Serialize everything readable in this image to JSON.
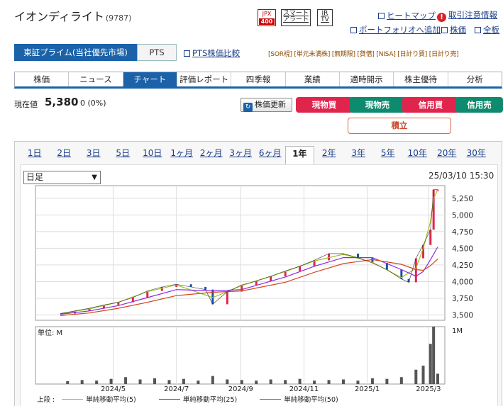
{
  "header": {
    "title": "イオンディライト",
    "code": "(9787)",
    "jpx_top": "JPX",
    "jpx_bottom": "400",
    "smart_alert_1": "スマート",
    "smart_alert_2": "アラート",
    "ir_1": "IR",
    "ir_2": "TV",
    "heatmap": "ヒートマップ",
    "caution": "取引注意情報",
    "portfolio": "ポートフォリオへ追加",
    "stock_price": "株価",
    "all_stocks": "全板"
  },
  "market": {
    "primary": "東証プライム(当社優先市場)",
    "pts": "PTS",
    "pts_compare": "PTS株価比較",
    "rules": "[SOR視] [単元未満株] [無期限] [貸借] [NISA] [日計り買] [日計り売]"
  },
  "nav": {
    "tabs": [
      "株価",
      "ニュース",
      "チャート",
      "評価レポート",
      "四季報",
      "業績",
      "適時開示",
      "株主優待",
      "分析"
    ],
    "active": 2
  },
  "quote": {
    "label": "現在値",
    "price": "5,380",
    "change": "0 (0%)",
    "refresh": "株価更新",
    "buy_spot": "現物買",
    "sell_spot": "現物売",
    "buy_margin": "信用買",
    "sell_margin": "信用売",
    "tsumitate": "積立"
  },
  "period": {
    "tabs": [
      "1日",
      "2日",
      "3日",
      "5日",
      "10日",
      "1ヶ月",
      "2ヶ月",
      "3ヶ月",
      "6ヶ月",
      "1年",
      "2年",
      "3年",
      "5年",
      "10年",
      "20年",
      "30年"
    ],
    "active": 9
  },
  "chart_controls": {
    "interval": "日足",
    "datetime": "25/03/10 15:30"
  },
  "chart_data": {
    "type": "line",
    "price_yticks": [
      3500,
      3750,
      4000,
      4250,
      4500,
      4750,
      5000,
      5250
    ],
    "price_ytick_labels": [
      "3,500",
      "3,750",
      "4,000",
      "4,250",
      "4,500",
      "4,750",
      "5,000",
      "5,250"
    ],
    "price_ylim": [
      3420,
      5440
    ],
    "x_range": [
      "2024-03-11",
      "2025-03-10"
    ],
    "x_ticks": [
      "2024/5",
      "2024/7",
      "2024/9",
      "2024/11",
      "2025/1",
      "2025/3"
    ],
    "volume_label": "単位: M",
    "volume_ytick": "1M",
    "close": [
      [
        "2024-03-11",
        3520
      ],
      [
        "2024-03-25",
        3560
      ],
      [
        "2024-04-08",
        3600
      ],
      [
        "2024-04-22",
        3650
      ],
      [
        "2024-05-06",
        3690
      ],
      [
        "2024-05-20",
        3760
      ],
      [
        "2024-06-03",
        3860
      ],
      [
        "2024-06-17",
        3920
      ],
      [
        "2024-07-01",
        3960
      ],
      [
        "2024-07-15",
        3920
      ],
      [
        "2024-07-29",
        3880
      ],
      [
        "2024-08-05",
        3660
      ],
      [
        "2024-08-19",
        3850
      ],
      [
        "2024-09-02",
        3950
      ],
      [
        "2024-09-16",
        4010
      ],
      [
        "2024-09-30",
        4080
      ],
      [
        "2024-10-14",
        4160
      ],
      [
        "2024-10-28",
        4230
      ],
      [
        "2024-11-11",
        4320
      ],
      [
        "2024-11-25",
        4420
      ],
      [
        "2024-12-09",
        4420
      ],
      [
        "2024-12-23",
        4360
      ],
      [
        "2025-01-06",
        4280
      ],
      [
        "2025-01-20",
        4180
      ],
      [
        "2025-02-03",
        4040
      ],
      [
        "2025-02-10",
        3990
      ],
      [
        "2025-02-17",
        4350
      ],
      [
        "2025-02-24",
        4550
      ],
      [
        "2025-03-03",
        4780
      ],
      [
        "2025-03-06",
        5380
      ],
      [
        "2025-03-10",
        5380
      ]
    ],
    "series": [
      {
        "name": "単純移動平均(5)",
        "color": "#9bc31c",
        "values": [
          [
            "2024-03-11",
            3520
          ],
          [
            "2024-04-08",
            3590
          ],
          [
            "2024-05-06",
            3690
          ],
          [
            "2024-06-03",
            3850
          ],
          [
            "2024-07-01",
            3950
          ],
          [
            "2024-08-05",
            3760
          ],
          [
            "2024-09-02",
            3940
          ],
          [
            "2024-10-14",
            4150
          ],
          [
            "2024-11-11",
            4310
          ],
          [
            "2024-12-09",
            4410
          ],
          [
            "2025-01-06",
            4290
          ],
          [
            "2025-02-03",
            4060
          ],
          [
            "2025-02-17",
            4200
          ],
          [
            "2025-02-24",
            4500
          ],
          [
            "2025-03-03",
            4900
          ],
          [
            "2025-03-06",
            5250
          ],
          [
            "2025-03-10",
            5380
          ]
        ]
      },
      {
        "name": "単純移動平均(25)",
        "color": "#8a2be2",
        "values": [
          [
            "2024-03-11",
            3510
          ],
          [
            "2024-04-08",
            3560
          ],
          [
            "2024-05-06",
            3640
          ],
          [
            "2024-06-03",
            3760
          ],
          [
            "2024-07-01",
            3880
          ],
          [
            "2024-08-05",
            3860
          ],
          [
            "2024-09-02",
            3880
          ],
          [
            "2024-10-14",
            4070
          ],
          [
            "2024-11-11",
            4230
          ],
          [
            "2024-12-09",
            4360
          ],
          [
            "2025-01-06",
            4360
          ],
          [
            "2025-02-03",
            4180
          ],
          [
            "2025-02-17",
            4080
          ],
          [
            "2025-02-24",
            4150
          ],
          [
            "2025-03-03",
            4330
          ],
          [
            "2025-03-10",
            4520
          ]
        ]
      },
      {
        "name": "単純移動平均(50)",
        "color": "#d2481c",
        "values": [
          [
            "2024-03-11",
            3490
          ],
          [
            "2024-04-08",
            3530
          ],
          [
            "2024-05-06",
            3600
          ],
          [
            "2024-06-03",
            3690
          ],
          [
            "2024-07-01",
            3790
          ],
          [
            "2024-08-05",
            3840
          ],
          [
            "2024-09-02",
            3860
          ],
          [
            "2024-10-14",
            3990
          ],
          [
            "2024-11-11",
            4140
          ],
          [
            "2024-12-09",
            4270
          ],
          [
            "2025-01-06",
            4330
          ],
          [
            "2025-02-03",
            4260
          ],
          [
            "2025-02-17",
            4180
          ],
          [
            "2025-02-24",
            4170
          ],
          [
            "2025-03-03",
            4240
          ],
          [
            "2025-03-10",
            4340
          ]
        ]
      }
    ],
    "volume": [
      [
        "2024-03-18",
        0.05
      ],
      [
        "2024-04-01",
        0.07
      ],
      [
        "2024-04-15",
        0.06
      ],
      [
        "2024-04-29",
        0.09
      ],
      [
        "2024-05-13",
        0.12
      ],
      [
        "2024-05-27",
        0.08
      ],
      [
        "2024-06-10",
        0.1
      ],
      [
        "2024-06-24",
        0.07
      ],
      [
        "2024-07-08",
        0.09
      ],
      [
        "2024-07-22",
        0.06
      ],
      [
        "2024-08-05",
        0.14
      ],
      [
        "2024-08-19",
        0.08
      ],
      [
        "2024-09-02",
        0.07
      ],
      [
        "2024-09-16",
        0.06
      ],
      [
        "2024-09-30",
        0.08
      ],
      [
        "2024-10-14",
        0.07
      ],
      [
        "2024-10-28",
        0.09
      ],
      [
        "2024-11-11",
        0.06
      ],
      [
        "2024-11-25",
        0.07
      ],
      [
        "2024-12-09",
        0.08
      ],
      [
        "2024-12-23",
        0.06
      ],
      [
        "2025-01-06",
        0.1
      ],
      [
        "2025-01-20",
        0.09
      ],
      [
        "2025-02-03",
        0.12
      ],
      [
        "2025-02-17",
        0.25
      ],
      [
        "2025-02-24",
        0.32
      ],
      [
        "2025-03-03",
        0.7
      ],
      [
        "2025-03-06",
        1.0
      ],
      [
        "2025-03-10",
        0.18
      ]
    ],
    "volume_ylim": [
      0,
      1
    ]
  },
  "legend": {
    "prefix": "上段 :",
    "items": [
      "単純移動平均(5)",
      "単純移動平均(25)",
      "単純移動平均(50)"
    ]
  }
}
